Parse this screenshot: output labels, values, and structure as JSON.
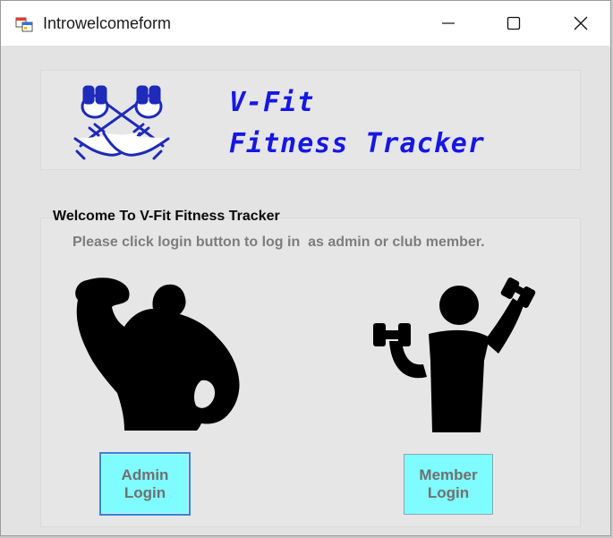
{
  "window": {
    "title": "Introwelcomeform",
    "controls": {
      "minimize": "minimize",
      "maximize": "maximize",
      "close": "close"
    }
  },
  "header": {
    "brand_line1": "V-Fit",
    "brand_line2": "Fitness Tracker",
    "brand_color": "#1616e6",
    "logo_icon": "crossed-dumbbells-arms-icon"
  },
  "welcome": {
    "title": "Welcome To V-Fit Fitness Tracker",
    "subtitle": "Please click login button to log in  as admin or club member."
  },
  "figures": {
    "admin": "bodybuilder-silhouette-icon",
    "member": "dumbbell-exercise-person-icon"
  },
  "buttons": {
    "admin": {
      "line1": "Admin",
      "line2": "Login",
      "bg": "#7ffcff"
    },
    "member": {
      "line1": "Member",
      "line2": "Login",
      "bg": "#7ffcff"
    }
  }
}
